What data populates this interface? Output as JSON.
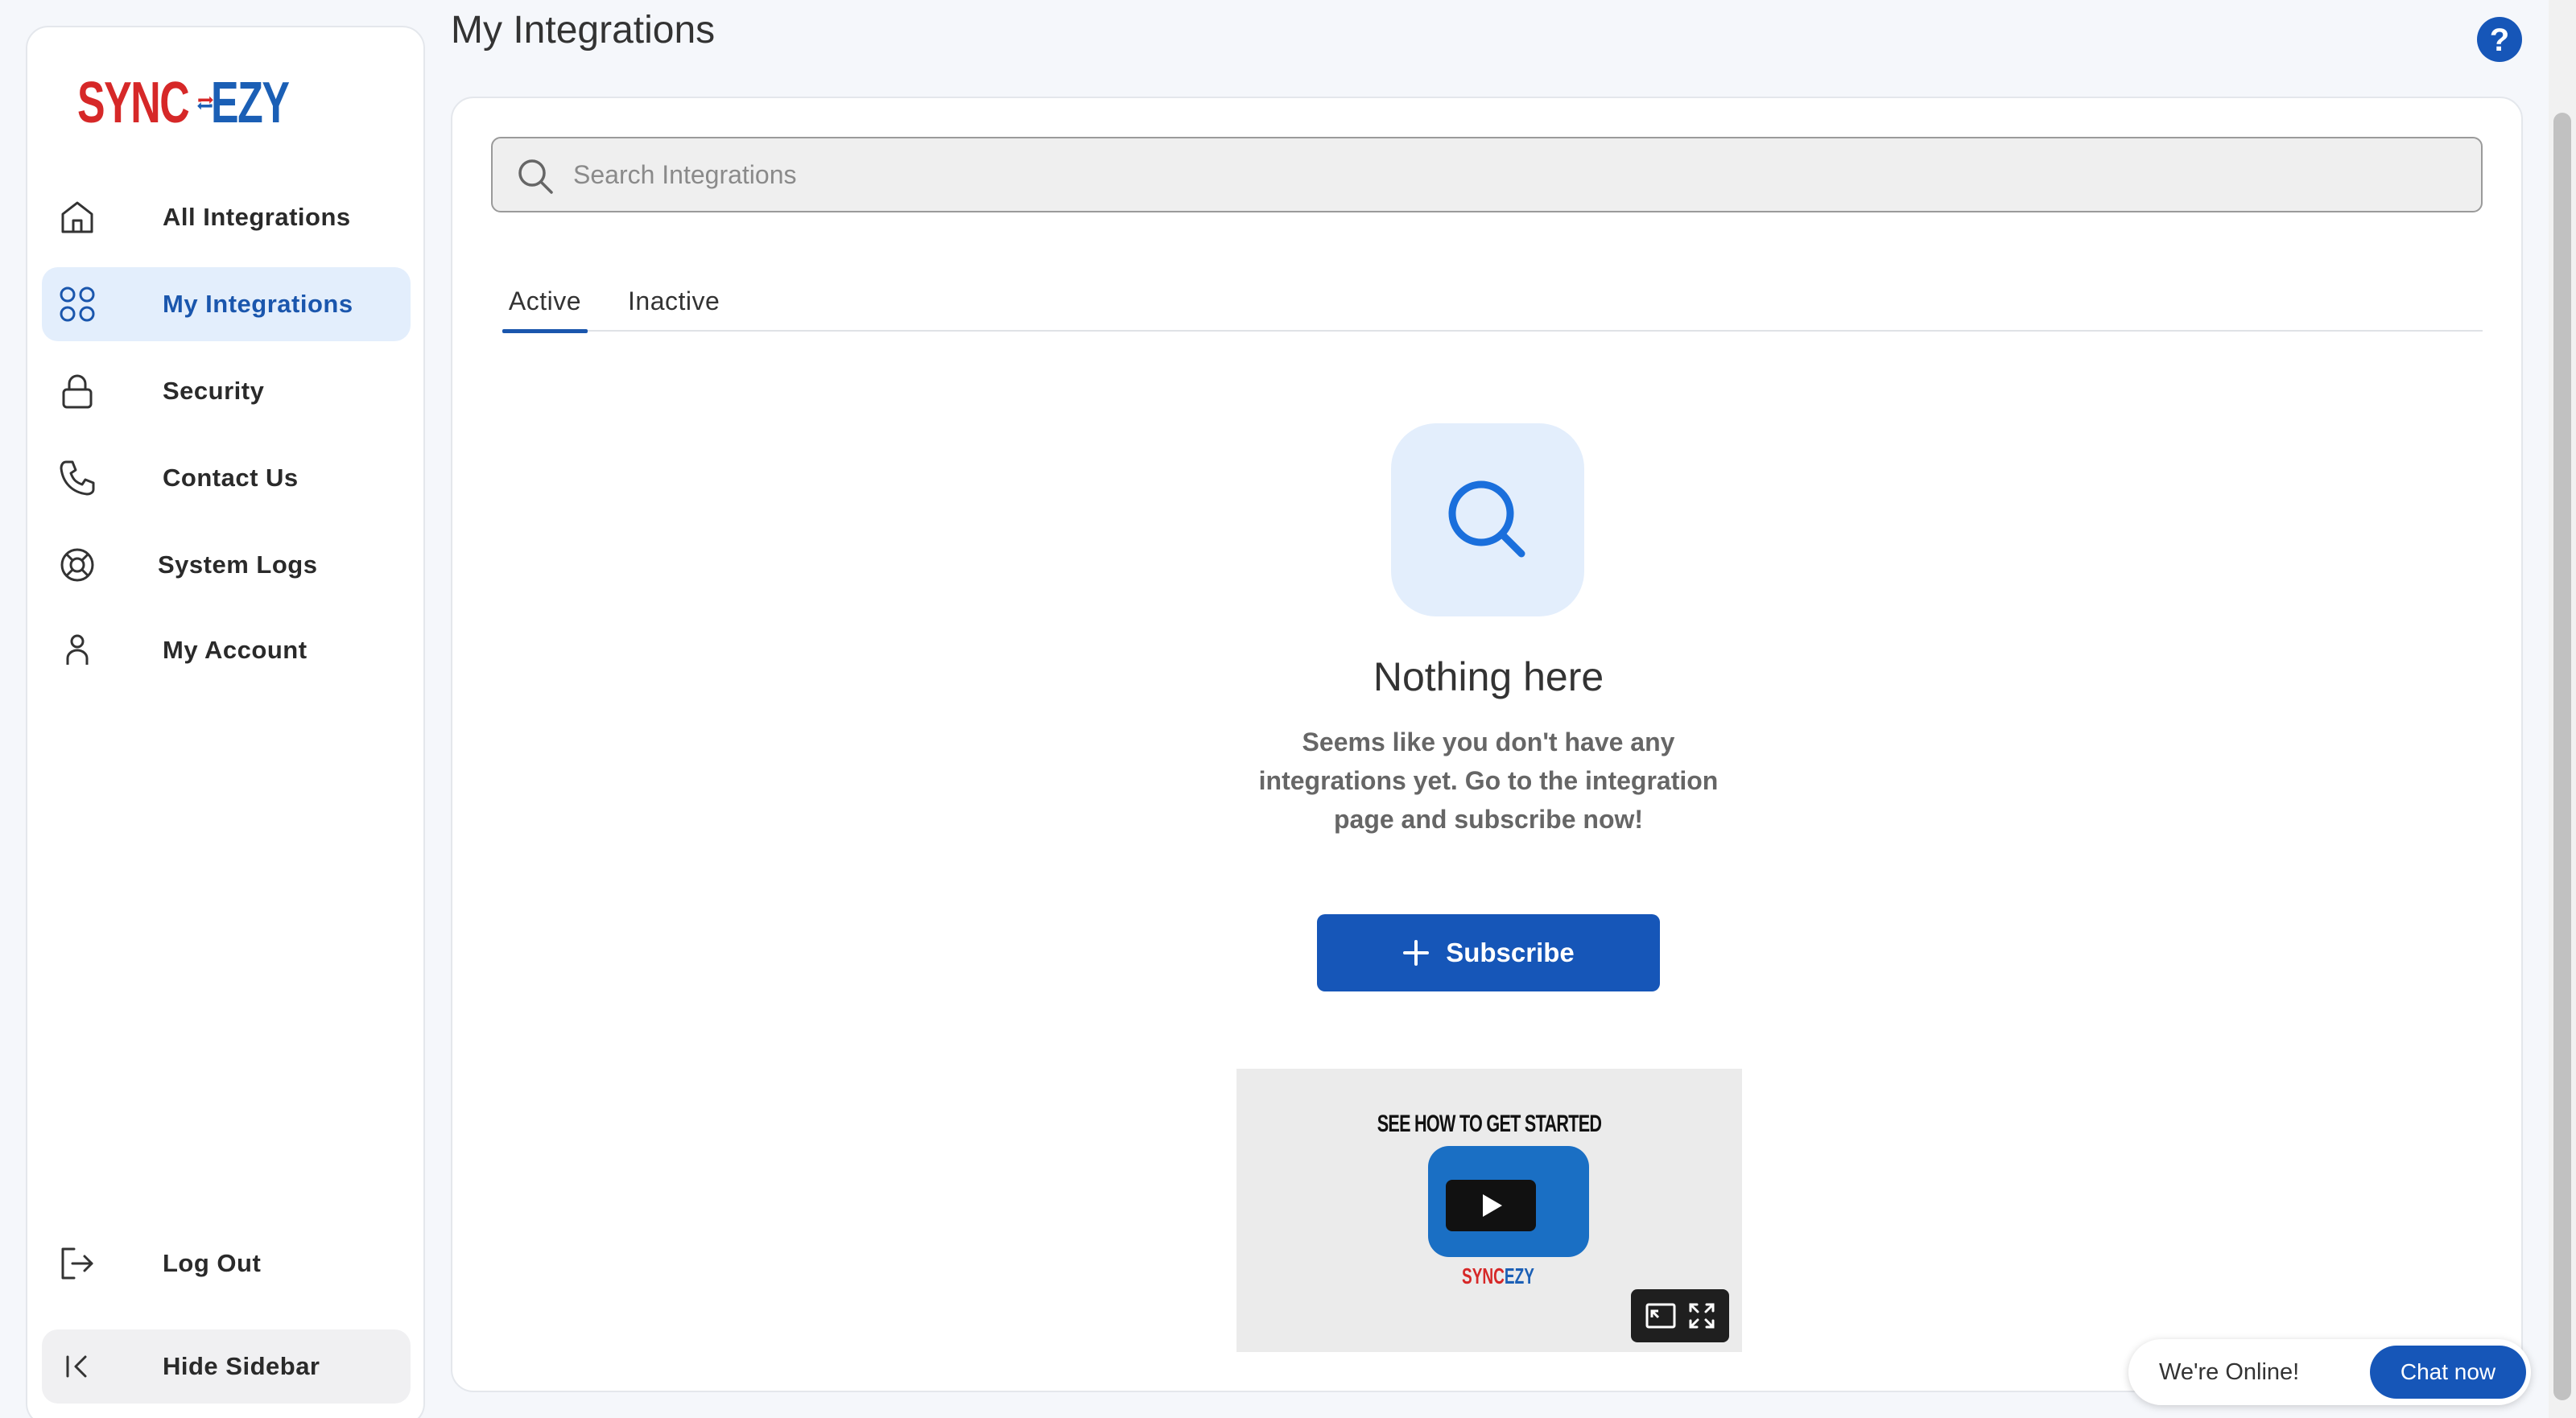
{
  "brand": {
    "logo_left": "SYNC",
    "logo_right": "EZY",
    "red": "#d62828",
    "blue": "#1b5fb5"
  },
  "sidebar": {
    "items": [
      {
        "label": "All Integrations",
        "icon": "home-icon"
      },
      {
        "label": "My Integrations",
        "icon": "grid-icon",
        "active": true
      },
      {
        "label": "Security",
        "icon": "lock-icon"
      },
      {
        "label": "Contact Us",
        "icon": "phone-icon"
      },
      {
        "label": "System Logs",
        "icon": "lifebuoy-icon"
      },
      {
        "label": "My Account",
        "icon": "user-icon"
      }
    ],
    "logout_label": "Log Out",
    "hide_label": "Hide Sidebar"
  },
  "header": {
    "title": "My Integrations",
    "help_icon": "help-icon"
  },
  "search": {
    "placeholder": "Search Integrations",
    "value": ""
  },
  "tabs": [
    {
      "label": "Active",
      "selected": true
    },
    {
      "label": "Inactive",
      "selected": false
    }
  ],
  "empty_state": {
    "title": "Nothing here",
    "description": "Seems like you don't have any integrations yet. Go to the integration page and subscribe now!",
    "button_label": "Subscribe"
  },
  "video": {
    "caption": "SEE HOW TO GET STARTED",
    "logo_left": "SYNC",
    "logo_right": "EZY"
  },
  "chat": {
    "status": "We're Online!",
    "button_label": "Chat now"
  },
  "colors": {
    "accent": "#1656b8",
    "active_bg": "#e3eefc"
  }
}
